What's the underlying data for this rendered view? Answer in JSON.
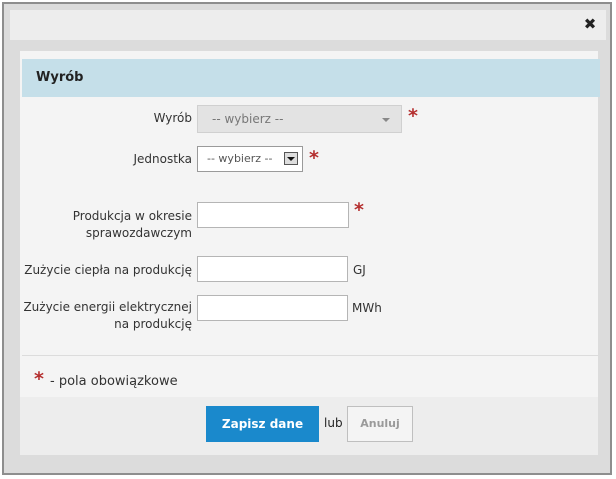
{
  "dialog": {
    "close_glyph": "✖"
  },
  "section": {
    "title": "Wyrób"
  },
  "form": {
    "product": {
      "label": "Wyrób",
      "value": "-- wybierz --",
      "required_mark": "*"
    },
    "unit": {
      "label": "Jednostka",
      "value": "-- wybierz --",
      "required_mark": "*"
    },
    "production": {
      "label_line1": "Produkcja w okresie",
      "label_line2": "sprawozdawczym",
      "value": "",
      "required_mark": "*"
    },
    "heat": {
      "label": "Zużycie ciepła na produkcję",
      "value": "",
      "unit": "GJ"
    },
    "electricity": {
      "label_line1": "Zużycie energii elektrycznej",
      "label_line2": "na produkcję",
      "value": "",
      "unit": "MWh"
    }
  },
  "legend": {
    "star": "*",
    "text": "- pola obowiązkowe"
  },
  "actions": {
    "save_label": "Zapisz dane",
    "or_label": "lub",
    "cancel_label": "Anuluj"
  },
  "colors": {
    "header_bg": "#c5dfe9",
    "primary_button": "#1a89cc",
    "required": "#b42e2e"
  }
}
